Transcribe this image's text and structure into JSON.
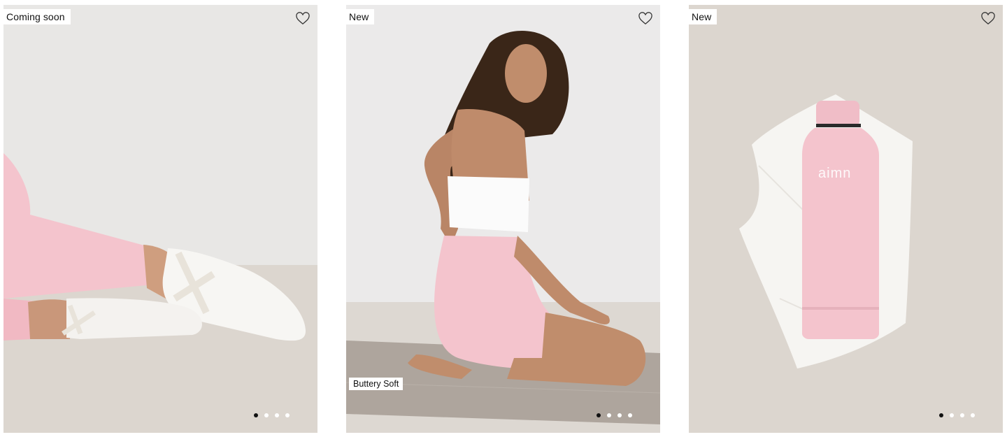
{
  "products": [
    {
      "badge": "Coming soon",
      "favorite_icon": "heart-outline-icon",
      "carousel": {
        "total": 4,
        "active": 1
      }
    },
    {
      "badge": "New",
      "secondary_badge": "Buttery Soft",
      "favorite_icon": "heart-outline-icon",
      "carousel": {
        "total": 4,
        "active": 1
      }
    },
    {
      "badge": "New",
      "favorite_icon": "heart-outline-icon",
      "product_logo": "aimn",
      "carousel": {
        "total": 4,
        "active": 1
      }
    }
  ],
  "colors": {
    "pink": "#f4c4cd",
    "card_bg_1": "#e9e8e6",
    "card_bg_2": "#ebeaea",
    "card_bg_3": "#dcd6cf"
  }
}
